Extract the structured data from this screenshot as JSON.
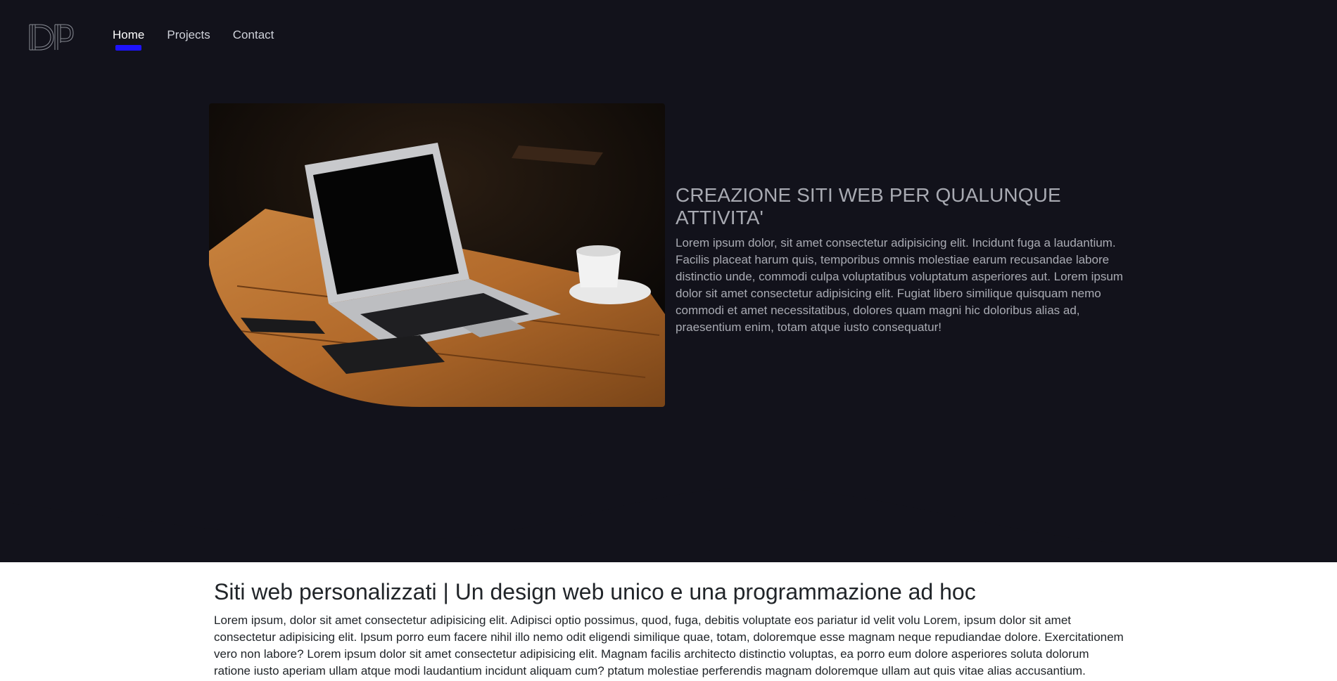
{
  "nav": {
    "logo": "DP",
    "links": [
      {
        "label": "Home",
        "active": true
      },
      {
        "label": "Projects",
        "active": false
      },
      {
        "label": "Contact",
        "active": false
      }
    ],
    "active_underline_color": "#1e13ff"
  },
  "hero": {
    "background_color": "#12121b",
    "image_alt": "laptop on wooden table with coffee cup",
    "title": "CREAZIONE SITI WEB PER QUALUNQUE ATTIVITA'",
    "description": "Lorem ipsum dolor, sit amet consectetur adipisicing elit. Incidunt fuga a laudantium. Facilis placeat harum quis, temporibus omnis molestiae earum recusandae labore distinctio unde, commodi culpa voluptatibus voluptatum asperiores aut. Lorem ipsum dolor sit amet consectetur adipisicing elit. Fugiat libero similique quisquam nemo commodi et amet necessitatibus, dolores quam magni hic doloribus alias ad, praesentium enim, totam atque iusto consequatur!"
  },
  "section": {
    "title": "Siti web personalizzati | Un design web unico e una programmazione ad hoc",
    "description": "Lorem ipsum, dolor sit amet consectetur adipisicing elit. Adipisci optio possimus, quod, fuga, debitis voluptate eos pariatur id velit volu Lorem, ipsum dolor sit amet consectetur adipisicing elit. Ipsum porro eum facere nihil illo nemo odit eligendi similique quae, totam, doloremque esse magnam neque repudiandae dolore. Exercitationem vero non labore? Lorem ipsum dolor sit amet consectetur adipisicing elit. Magnam facilis architecto distinctio voluptas, ea porro eum dolore asperiores soluta dolorum ratione iusto aperiam ullam atque modi laudantium incidunt aliquam cum? ptatum molestiae perferendis magnam doloremque ullam aut quis vitae alias accusantium."
  }
}
